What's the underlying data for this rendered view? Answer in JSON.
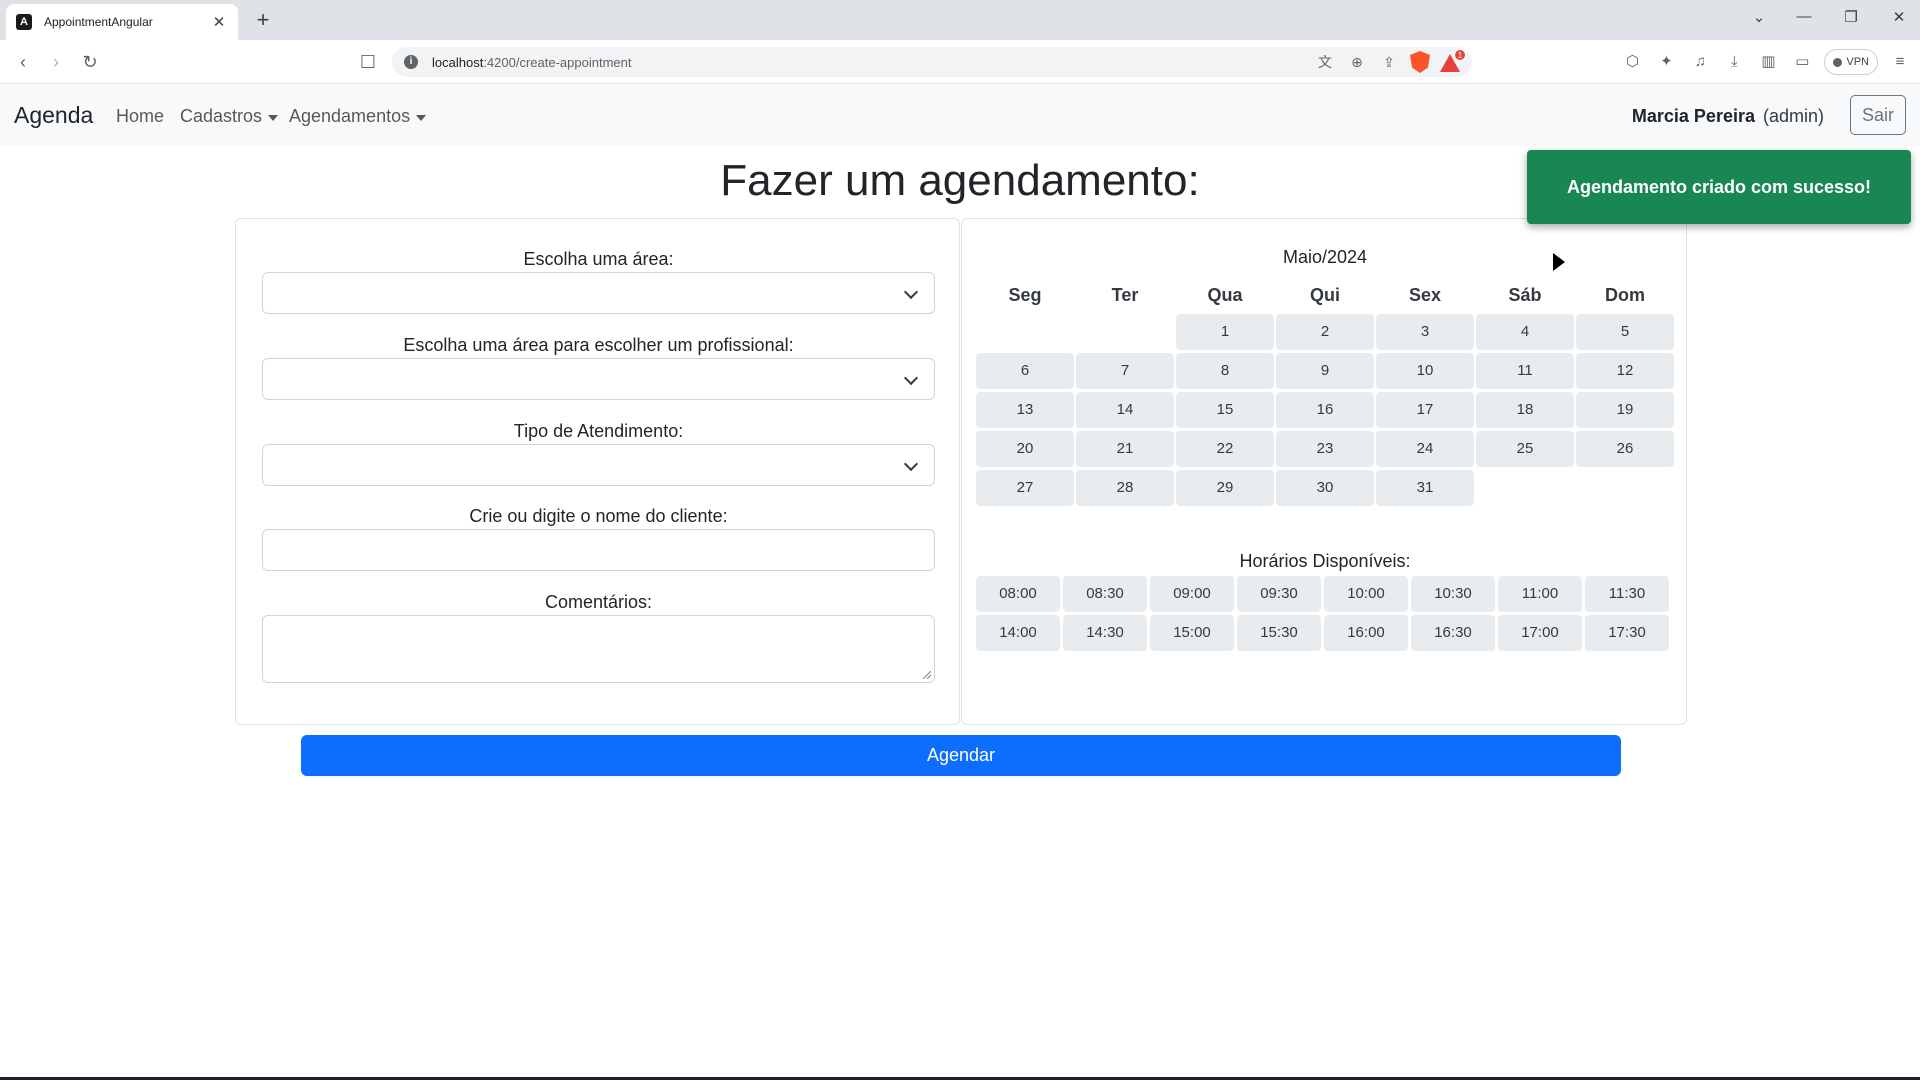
{
  "browser": {
    "tab_title": "AppointmentAngular",
    "tab_favicon": "A",
    "url_host": "localhost",
    "url_path": ":4200/create-appointment",
    "notification_badge": "1",
    "vpn_label": "VPN"
  },
  "navbar": {
    "brand": "Agenda",
    "links": {
      "home": "Home",
      "cadastros": "Cadastros",
      "agendamentos": "Agendamentos"
    },
    "user_name": "Marcia Pereira",
    "user_role": "(admin)",
    "logout_label": "Sair"
  },
  "toast": {
    "message": "Agendamento criado com sucesso!",
    "color": "#198754"
  },
  "page": {
    "title": "Fazer um agendamento:"
  },
  "form": {
    "area_label": "Escolha uma área:",
    "professional_label": "Escolha uma área para escolher um profissional:",
    "service_type_label": "Tipo de Atendimento:",
    "client_label": "Crie ou digite o nome do cliente:",
    "comments_label": "Comentários:",
    "area_value": "",
    "professional_value": "",
    "service_type_value": "",
    "client_value": "",
    "comments_value": ""
  },
  "calendar": {
    "month_label": "Maio/2024",
    "weekdays": [
      "Seg",
      "Ter",
      "Qua",
      "Qui",
      "Sex",
      "Sáb",
      "Dom"
    ],
    "days": [
      "",
      "",
      "1",
      "2",
      "3",
      "4",
      "5",
      "6",
      "7",
      "8",
      "9",
      "10",
      "11",
      "12",
      "13",
      "14",
      "15",
      "16",
      "17",
      "18",
      "19",
      "20",
      "21",
      "22",
      "23",
      "24",
      "25",
      "26",
      "27",
      "28",
      "29",
      "30",
      "31"
    ]
  },
  "times": {
    "label": "Horários Disponíveis:",
    "slots": [
      "08:00",
      "08:30",
      "09:00",
      "09:30",
      "10:00",
      "10:30",
      "11:00",
      "11:30",
      "14:00",
      "14:30",
      "15:00",
      "15:30",
      "16:00",
      "16:30",
      "17:00",
      "17:30"
    ]
  },
  "submit": {
    "label": "Agendar",
    "color": "#0d6efd"
  }
}
